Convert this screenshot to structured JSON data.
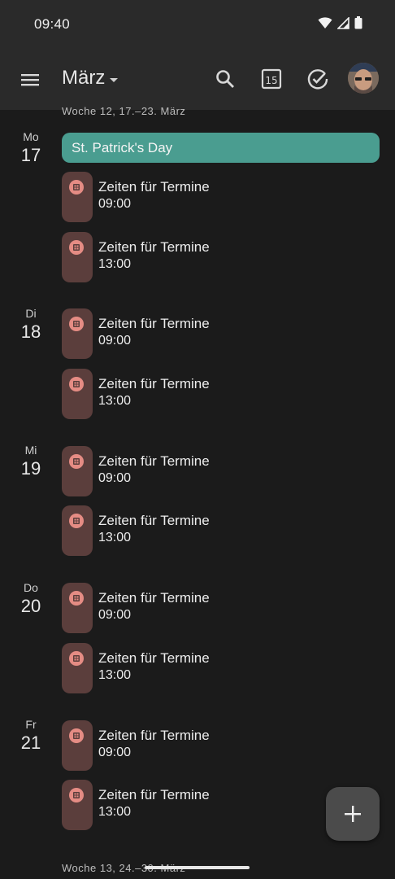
{
  "status_bar": {
    "time": "09:40"
  },
  "app_bar": {
    "month": "März",
    "today_day": "15",
    "icons": [
      "menu-icon",
      "search-icon",
      "today-calendar-icon",
      "tasks-check-icon",
      "profile-avatar"
    ]
  },
  "weeks": {
    "top_label": "Woche 12, 17.–23. März",
    "bottom_label": "Woche 13, 24.–30. März"
  },
  "allday_event": {
    "title": "St. Patrick's Day",
    "color": "#4a9d90"
  },
  "event_chip_color": "#5b3e3c",
  "days": [
    {
      "name": "Mo",
      "num": "17",
      "events": [
        {
          "title": "Zeiten für Termine",
          "time": "09:00"
        },
        {
          "title": "Zeiten für Termine",
          "time": "13:00"
        }
      ]
    },
    {
      "name": "Di",
      "num": "18",
      "events": [
        {
          "title": "Zeiten für Termine",
          "time": "09:00"
        },
        {
          "title": "Zeiten für Termine",
          "time": "13:00"
        }
      ]
    },
    {
      "name": "Mi",
      "num": "19",
      "events": [
        {
          "title": "Zeiten für Termine",
          "time": "09:00"
        },
        {
          "title": "Zeiten für Termine",
          "time": "13:00"
        }
      ]
    },
    {
      "name": "Do",
      "num": "20",
      "events": [
        {
          "title": "Zeiten für Termine",
          "time": "09:00"
        },
        {
          "title": "Zeiten für Termine",
          "time": "13:00"
        }
      ]
    },
    {
      "name": "Fr",
      "num": "21",
      "events": [
        {
          "title": "Zeiten für Termine",
          "time": "09:00"
        },
        {
          "title": "Zeiten für Termine",
          "time": "13:00"
        }
      ]
    }
  ],
  "fab": {
    "icon": "plus-icon"
  }
}
